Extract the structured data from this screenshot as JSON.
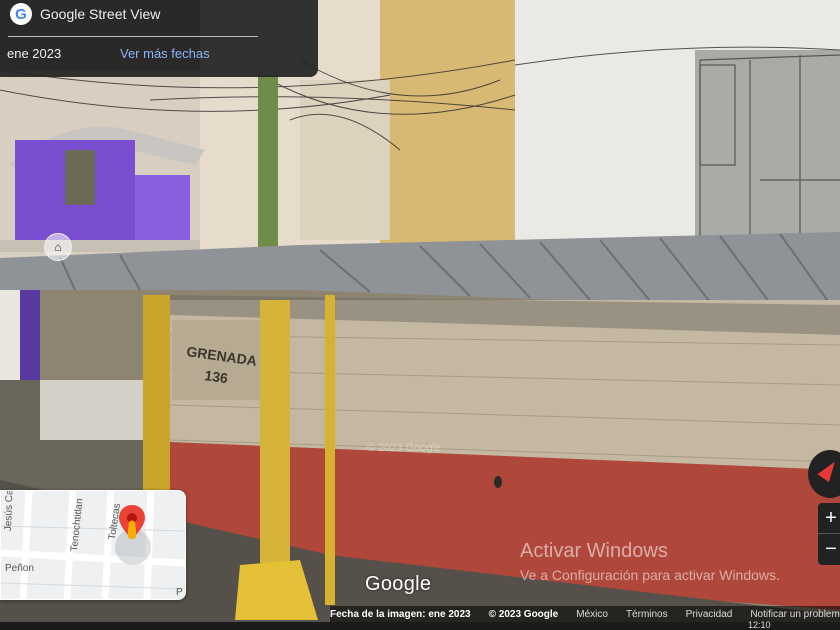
{
  "street_view": {
    "title": "Google Street View",
    "logo_letter": "G",
    "capture_date": "ene 2023",
    "more_dates_link": "Ver más fechas"
  },
  "scene": {
    "wall_painted_text_line1": "GRENADA",
    "wall_painted_text_line2": "136",
    "watermark": "© 2023 Google",
    "google_wordmark": "Google"
  },
  "minimap": {
    "streets": [
      "Jesús Carranza",
      "Tenochtitlan",
      "Toltecas",
      "Peñon",
      "P"
    ]
  },
  "windows_activation": {
    "title": "Activar Windows",
    "subtitle": "Ve a Configuración para activar Windows."
  },
  "footer": {
    "image_date": "Fecha de la imagen: ene 2023",
    "copyright": "© 2023 Google",
    "country": "México",
    "terms": "Términos",
    "privacy": "Privacidad",
    "report": "Notificar un problema"
  },
  "controls": {
    "zoom_in": "+",
    "zoom_out": "−"
  },
  "taskbar": {
    "time": "12:10"
  },
  "colors": {
    "panel_bg": "#222222",
    "link_blue": "#8ab4f8",
    "pin_red": "#ea4335",
    "pegman_yellow": "#f9ab00"
  }
}
